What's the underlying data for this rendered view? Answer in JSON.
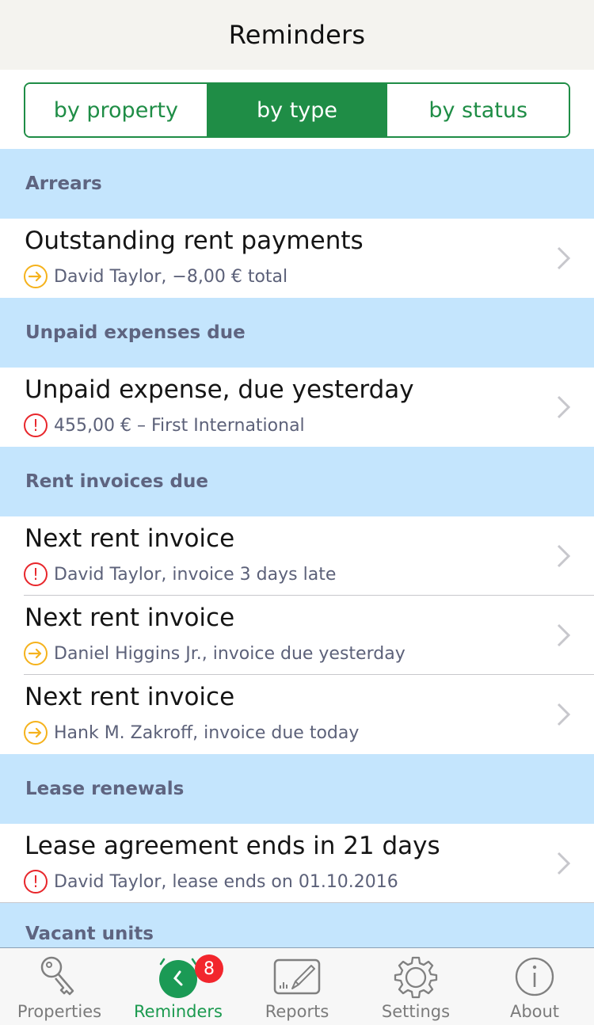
{
  "nav": {
    "title": "Reminders"
  },
  "segments": [
    {
      "label": "by property",
      "active": false
    },
    {
      "label": "by type",
      "active": true
    },
    {
      "label": "by status",
      "active": false
    }
  ],
  "colors": {
    "accent": "#1f8d46",
    "section_bg": "#c4e5fd",
    "warning": "#f5b21c",
    "alert": "#e8262b",
    "badge": "#f2262d"
  },
  "sections": [
    {
      "header": "Arrears",
      "rows": [
        {
          "title": "Outstanding rent payments",
          "status_icon": "arrow-right-circle-icon",
          "status": "warning",
          "subtitle": "David Taylor, −8,00 € total"
        }
      ]
    },
    {
      "header": "Unpaid expenses due",
      "rows": [
        {
          "title": "Unpaid expense, due yesterday",
          "status_icon": "exclamation-circle-icon",
          "status": "alert",
          "subtitle": "455,00 € – First International"
        }
      ]
    },
    {
      "header": "Rent invoices due",
      "rows": [
        {
          "title": "Next rent invoice",
          "status_icon": "exclamation-circle-icon",
          "status": "alert",
          "subtitle": "David Taylor, invoice 3 days late"
        },
        {
          "title": "Next rent invoice",
          "status_icon": "arrow-right-circle-icon",
          "status": "warning",
          "subtitle": "Daniel Higgins Jr., invoice due yesterday"
        },
        {
          "title": "Next rent invoice",
          "status_icon": "arrow-right-circle-icon",
          "status": "warning",
          "subtitle": "Hank M. Zakroff, invoice due today"
        }
      ]
    },
    {
      "header": "Lease renewals",
      "rows": [
        {
          "title": "Lease agreement ends in 21 days",
          "status_icon": "exclamation-circle-icon",
          "status": "alert",
          "subtitle": "David Taylor, lease ends on 01.10.2016"
        }
      ]
    },
    {
      "header": "Vacant units",
      "rows": []
    }
  ],
  "tabs": [
    {
      "label": "Properties",
      "icon": "key-icon",
      "active": false
    },
    {
      "label": "Reminders",
      "icon": "alarm-clock-icon",
      "active": true,
      "badge": "8"
    },
    {
      "label": "Reports",
      "icon": "report-edit-icon",
      "active": false
    },
    {
      "label": "Settings",
      "icon": "gear-icon",
      "active": false
    },
    {
      "label": "About",
      "icon": "info-icon",
      "active": false
    }
  ]
}
